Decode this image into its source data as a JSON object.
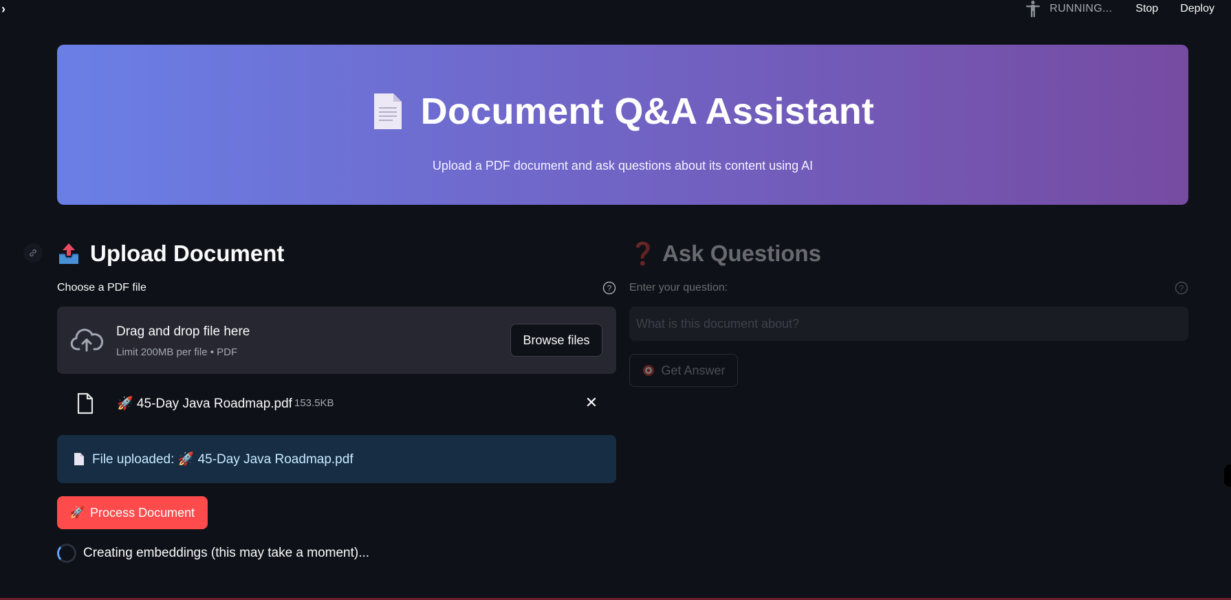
{
  "topbar": {
    "status_text": "RUNNING...",
    "stop_label": "Stop",
    "deploy_label": "Deploy"
  },
  "hero": {
    "title": "Document Q&A Assistant",
    "subtitle": "Upload a PDF document and ask questions about its content using AI"
  },
  "upload": {
    "heading": "Upload Document",
    "label": "Choose a PDF file",
    "drop_title": "Drag and drop file here",
    "drop_limit": "Limit 200MB per file • PDF",
    "browse_label": "Browse files",
    "file_name": "🚀 45-Day Java Roadmap.pdf",
    "file_size": "153.5KB",
    "info_text": "File uploaded: 🚀 45-Day Java Roadmap.pdf",
    "process_label": "Process Document",
    "process_icon": "🚀",
    "spinner_text": "Creating embeddings (this may take a moment)..."
  },
  "questions": {
    "heading": "Ask Questions",
    "heading_icon": "❓",
    "label": "Enter your question:",
    "placeholder": "What is this document about?",
    "button_label": "Get Answer"
  },
  "colors": {
    "background": "#0e1117",
    "hero_start": "#6a7fe6",
    "hero_end": "#764ba2",
    "primary_button": "#ff4b4b",
    "info_bg": "#172d43"
  }
}
